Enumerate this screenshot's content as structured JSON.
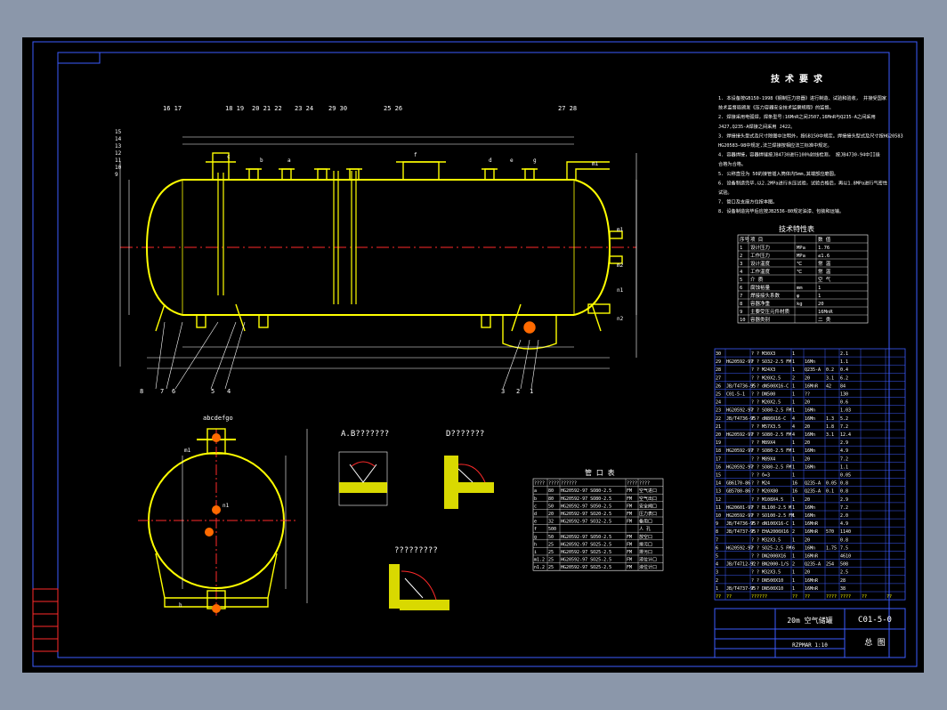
{
  "drawing": {
    "title_main": "20m 空气储罐",
    "drawing_no": "C01-5-0",
    "drawing_kind": "总 图",
    "scale_note": "RZPMAR  1:10"
  },
  "tech_req": {
    "title": "技 术 要 求",
    "lines": [
      "1. 本设备按GB150-1998《钢制压力容器》进行制造、试验和验收，    并接受国家",
      "技术监督局颁发《压力容器安全技术监察规程》的监督。",
      "2. 焊接采用电弧焊，焊条型号:16MnR之间J507,16MnR与Q235-A之间采用",
      "J427,Q235-A焊接之间采用  J422。",
      "3. 焊接接头型式及尺寸除图中注明外，按GB150中规定。焊接接头型式及尺寸按HG20583",
      "HG20583—98中规定,法兰焊接按相应法兰标准中规定。",
      "4. 容器焊接，容器焊缝按JB4730进行100%射线检测，   按JB4730-94中II级",
      "合格为合格。",
      "5. 公称直径为 50的接管插入筒体内5mm,其端部应磨圆。",
      "6. 设备制造完毕,以2.2MPa进行水压试验，试验合格后，再以1.8MPa进行气密性",
      "试验。",
      "7. 管口及支座方位按本图。",
      "8. 设备制造完毕后应按JB2536-80规定油漆、包装和运输。"
    ]
  },
  "char_table": {
    "title": "技术特性表",
    "headers": [
      "序号",
      "项  目",
      "",
      "数  值"
    ],
    "rows": [
      [
        "1",
        "设计压力",
        "MPa",
        "1.76"
      ],
      [
        "2",
        "工作压力",
        "MPa",
        "≤1.6"
      ],
      [
        "3",
        "设计温度",
        "℃",
        "常 温"
      ],
      [
        "4",
        "工作温度",
        "℃",
        "常 温"
      ],
      [
        "5",
        "介   质",
        "",
        "空 气"
      ],
      [
        "6",
        "腐蚀裕量",
        "mm",
        "1"
      ],
      [
        "7",
        "焊接接头系数",
        "φ",
        "1"
      ],
      [
        "8",
        "容器净重",
        "kg",
        "20"
      ],
      [
        "9",
        "主要受压元件材质",
        "",
        "16MnR"
      ],
      [
        "10",
        "容器类别",
        "",
        "二 类"
      ]
    ]
  },
  "nozzle_table": {
    "title": "管 口 表",
    "headers": [
      "????",
      "????",
      "??????",
      "????",
      "????"
    ],
    "rows": [
      [
        "a",
        "80",
        "HG20592-97 SO80-2.5",
        "FM",
        "空气进口"
      ],
      [
        "b",
        "80",
        "HG20592-97 SO80-2.5",
        "FM",
        "空气出口"
      ],
      [
        "c",
        "50",
        "HG20592-97 SO50-2.5",
        "FM",
        "安全阀口"
      ],
      [
        "d",
        "20",
        "HG20592-97 SO20-2.5",
        "FM",
        "压力表口"
      ],
      [
        "e",
        "32",
        "HG20592-97 SO32-2.5",
        "FM",
        "备用口"
      ],
      [
        "f",
        "500",
        "",
        "",
        "人 孔"
      ],
      [
        "g",
        "50",
        "HG20592-97 SO50-2.5",
        "FM",
        "放空口"
      ],
      [
        "h",
        "25",
        "HG20592-97 SO25-2.5",
        "FM",
        "排污口"
      ],
      [
        "i",
        "25",
        "HG20592-97 SO25-2.5",
        "FM",
        "排污口"
      ],
      [
        "m1.2",
        "25",
        "HG20592-97 SO25-2.5",
        "FM",
        "液位计口"
      ],
      [
        "n1.2",
        "25",
        "HG20592-97 SO25-2.5",
        "FM",
        "液位计口"
      ]
    ]
  },
  "views": {
    "ab_title": "A.B???????",
    "d_title": "D???????",
    "e_title": "?????????",
    "left_view_label": "abcdefgo",
    "callouts_top": [
      "16 17",
      "18 19",
      "20 21 22",
      "23 24",
      "29 30",
      "25 26",
      "27 28"
    ],
    "callouts_bottom": [
      "8",
      "7",
      "6",
      "5",
      "4",
      "3",
      "2",
      "1"
    ],
    "nozzle_letters_top": [
      "c",
      "b",
      "a",
      "f",
      "d",
      "e",
      "g",
      "m1"
    ],
    "nozzle_letters_side": [
      "m1",
      "m2",
      "n1",
      "n2"
    ],
    "left_side_marks": [
      "15",
      "14",
      "13",
      "12",
      "11",
      "10",
      "9"
    ],
    "left_view_letters": [
      "m1",
      "n1",
      "h"
    ]
  },
  "bom": {
    "rows": [
      [
        "30",
        "",
        "? ? M30X3",
        "1",
        "",
        "",
        "2.1"
      ],
      [
        "29",
        "HG20592-97",
        "? ? SO32-2.5 FM",
        "1",
        "16Mn",
        "",
        "1.1"
      ],
      [
        "28",
        "",
        "? ? M24X3",
        "1",
        "Q235-A",
        "0.2",
        "0.4"
      ],
      [
        "27",
        "",
        "? ? M20X2.5",
        "2",
        "20",
        "3.1",
        "6.2"
      ],
      [
        "26",
        "JB/T4736-95",
        "? ? dN500X16-C",
        "1",
        "16MnR",
        "42",
        "84"
      ],
      [
        "25",
        "C01-5-1",
        "? ? DN500",
        "1",
        "??",
        "",
        "130"
      ],
      [
        "24",
        "",
        "? ? M20X2.5",
        "1",
        "20",
        "",
        "0.6"
      ],
      [
        "23",
        "HG20592-97",
        "? ? SO80-2.5 FM",
        "1",
        "16Mn",
        "",
        "1.03"
      ],
      [
        "22",
        "JB/T4736-95",
        "? ? dN80X16-C",
        "4",
        "16Mn",
        "1.3",
        "5.2"
      ],
      [
        "21",
        "",
        "? ? M57X3.5",
        "4",
        "20",
        "1.8",
        "7.2"
      ],
      [
        "20",
        "HG20592-97",
        "? ? SO80-2.5 FM",
        "4",
        "16Mn",
        "3.1",
        "12.4"
      ],
      [
        "19",
        "",
        "? ? M89X4",
        "1",
        "20",
        "",
        "2.9"
      ],
      [
        "18",
        "HG20592-97",
        "? ? SO80-2.5 FM",
        "1",
        "16Mn",
        "",
        "4.9"
      ],
      [
        "17",
        "",
        "? ? M89X4",
        "1",
        "20",
        "",
        "7.2"
      ],
      [
        "16",
        "HG20592-97",
        "? ? SO80-2.5 FM",
        "1",
        "16Mn",
        "",
        "1.1"
      ],
      [
        "15",
        "",
        "? ? δ=3",
        "1",
        "",
        "",
        "0.05"
      ],
      [
        "14",
        "GB6170-86",
        "? ? M24",
        "16",
        "Q235-A",
        "0.05",
        "0.8"
      ],
      [
        "13",
        "GB5780-86",
        "? ? M20X80",
        "16",
        "Q235-A",
        "0.1",
        "0.8"
      ],
      [
        "12",
        "",
        "? ? M108X4.5",
        "1",
        "20",
        "",
        "2.9"
      ],
      [
        "11",
        "HG20601-97",
        "? ? BL100-2.5 M",
        "1",
        "16Mn",
        "",
        "7.2"
      ],
      [
        "10",
        "HG20592-97",
        "? ? SO100-2.5 FM",
        "1",
        "16Mn",
        "",
        "2.0"
      ],
      [
        "9",
        "JB/T4736-95",
        "? ? dN100X16-C",
        "1",
        "16MnR",
        "",
        "4.9"
      ],
      [
        "8",
        "JB/T4737-95",
        "? ? EHA2000X16",
        "2",
        "16MnR",
        "570",
        "1140"
      ],
      [
        "7",
        "",
        "? ? M32X3.5",
        "1",
        "20",
        "",
        "0.8"
      ],
      [
        "6",
        "HG20592-97",
        "? ? SO25-2.5 FM",
        "6",
        "16Mn",
        "1.75",
        "7.5"
      ],
      [
        "5",
        "",
        "? ? DN2000X16",
        "1",
        "16MnR",
        "",
        "4610"
      ],
      [
        "4",
        "JB/T4712-92",
        "? ? BN2000-1/S",
        "2",
        "Q235-A",
        "254",
        "508"
      ],
      [
        "3",
        "",
        "? ? M32X3.5",
        "1",
        "20",
        "",
        "2.5"
      ],
      [
        "2",
        "",
        "? ? DN500X10",
        "1",
        "16MnR",
        "",
        "28"
      ],
      [
        "1",
        "JB/T4737-95",
        "? ? DN500X10",
        "1",
        "16MnR",
        "",
        "38"
      ]
    ],
    "header": [
      "??",
      "??",
      "??????",
      "??",
      "??",
      "????",
      "????",
      "??",
      "??"
    ]
  },
  "colors": {
    "paper": "#000000",
    "frame": "#3d5cff",
    "vessel": "#ffff00",
    "center": "#ff2a2a",
    "text": "#ffffff",
    "dim": "#ffffff",
    "outer": "#8b97aa"
  }
}
